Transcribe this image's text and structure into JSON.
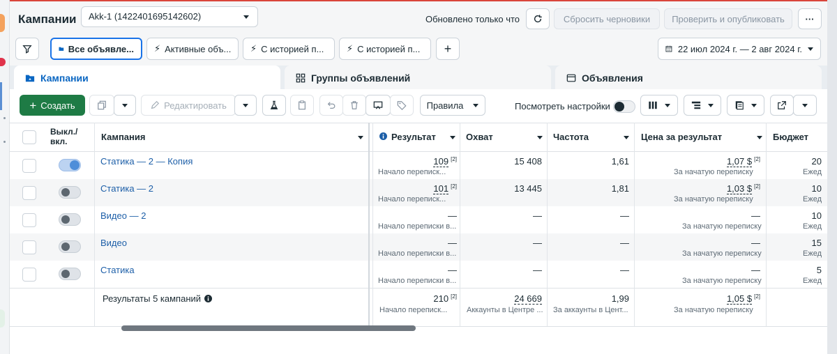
{
  "header": {
    "title": "Кампании",
    "account": "Akk-1 (1422401695142602)",
    "updated_text": "Обновлено только что",
    "reset_drafts": "Сбросить черновики",
    "review_publish": "Проверить и опубликовать",
    "more": "···"
  },
  "filters": {
    "items": [
      {
        "label": "Все объявле..."
      },
      {
        "label": "Активные объ..."
      },
      {
        "label": "С историей п..."
      },
      {
        "label": "С историей п..."
      }
    ],
    "add": "+",
    "date_range": "22 июл 2024 г. — 2 авг 2024 г."
  },
  "tabs": [
    {
      "label": "Кампании"
    },
    {
      "label": "Группы объявлений"
    },
    {
      "label": "Объявления"
    }
  ],
  "toolbar": {
    "create": "Создать",
    "edit": "Редактировать",
    "rules": "Правила",
    "view_settings": "Посмотреть настройки"
  },
  "columns": {
    "toggle": "Выкл./ вкл.",
    "campaign": "Кампания",
    "result": "Результат",
    "reach": "Охват",
    "frequency": "Частота",
    "cost_per_result": "Цена за результат",
    "budget": "Бюджет"
  },
  "rows": [
    {
      "name": "Статика — 2 — Копия",
      "on": true,
      "result": "109",
      "result_note": "[2]",
      "result_sub": "Начало переписк...",
      "reach": "15 408",
      "frequency": "1,61",
      "cost": "1,07 $",
      "cost_note": "[2]",
      "cost_sub": "За начатую переписку",
      "budget": "20",
      "budget_sub": "Ежед"
    },
    {
      "name": "Статика — 2",
      "on": false,
      "result": "101",
      "result_note": "[2]",
      "result_sub": "Начало переписк...",
      "reach": "13 445",
      "frequency": "1,81",
      "cost": "1,03 $",
      "cost_note": "[2]",
      "cost_sub": "За начатую переписку",
      "budget": "10",
      "budget_sub": "Ежед"
    },
    {
      "name": "Видео — 2",
      "on": false,
      "result": "—",
      "result_note": "",
      "result_sub": "Начало переписки в...",
      "reach": "—",
      "frequency": "—",
      "cost": "—",
      "cost_note": "",
      "cost_sub": "За начатую переписку",
      "budget": "10",
      "budget_sub": "Ежед"
    },
    {
      "name": "Видео",
      "on": false,
      "result": "—",
      "result_note": "",
      "result_sub": "Начало переписки в...",
      "reach": "—",
      "frequency": "—",
      "cost": "—",
      "cost_note": "",
      "cost_sub": "За начатую переписку",
      "budget": "15",
      "budget_sub": "Ежед"
    },
    {
      "name": "Статика",
      "on": false,
      "result": "—",
      "result_note": "",
      "result_sub": "Начало переписки в...",
      "reach": "—",
      "frequency": "—",
      "cost": "—",
      "cost_note": "",
      "cost_sub": "За начатую переписку",
      "budget": "5",
      "budget_sub": "Ежед"
    }
  ],
  "totals": {
    "label": "Результаты 5 кампаний",
    "result": "210",
    "result_note": "[2]",
    "result_sub": "Начало переписк...",
    "reach": "24 669",
    "reach_sub": "Аккаунты в Центре ...",
    "frequency": "1,99",
    "frequency_sub": "За аккаунты в Цент...",
    "cost": "1,05 $",
    "cost_note": "[2]",
    "cost_sub": "За начатую переписку"
  },
  "colors": {
    "accent": "#0a66c2",
    "create": "#1e7b45"
  }
}
